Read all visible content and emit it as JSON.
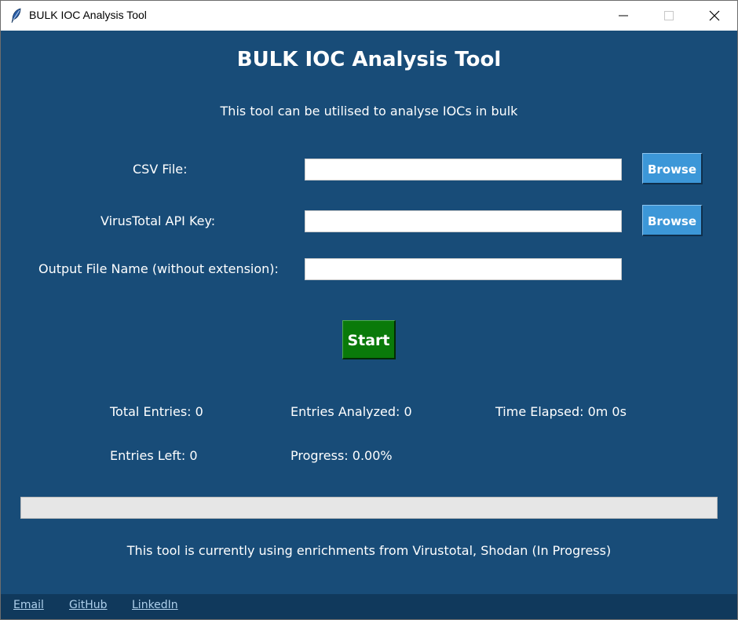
{
  "window": {
    "title": "BULK IOC Analysis Tool"
  },
  "header": {
    "title": "BULK IOC Analysis Tool",
    "subtitle": "This tool can be utilised to analyse IOCs in bulk"
  },
  "form": {
    "csv_label": "CSV File:",
    "csv_value": "",
    "api_label": "VirusTotal API Key:",
    "api_value": "",
    "output_label": "Output File Name (without extension):",
    "output_value": "",
    "browse_label": "Browse",
    "start_label": "Start"
  },
  "stats": {
    "total_entries": "Total Entries: 0",
    "entries_analyzed": "Entries Analyzed: 0",
    "time_elapsed": "Time Elapsed: 0m 0s",
    "entries_left": "Entries Left: 0",
    "progress_text": "Progress: 0.00%",
    "progress_fraction": 0
  },
  "footer": {
    "note": "This tool is currently using enrichments from Virustotal, Shodan (In Progress)",
    "links": [
      "Email",
      "GitHub",
      "LinkedIn"
    ]
  },
  "colors": {
    "background": "#184c78",
    "browse_button": "#3c97d8",
    "start_button": "#0a7a0a",
    "bottom_bar": "#10395c",
    "link": "#aed0ec"
  },
  "icons": {
    "app": "feather-icon",
    "minimize": "minimize-icon",
    "maximize": "maximize-icon",
    "close": "close-icon"
  }
}
